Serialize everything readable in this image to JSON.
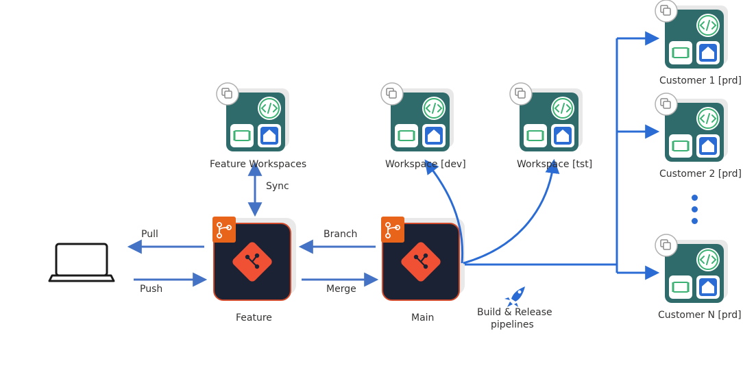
{
  "labels": {
    "pull": "Pull",
    "push": "Push",
    "feature": "Feature",
    "sync": "Sync",
    "feature_ws": "Feature Workspaces",
    "branch": "Branch",
    "merge": "Merge",
    "main": "Main",
    "ws_dev": "Workspace [dev]",
    "ws_tst": "Workspace [tst]",
    "pipelines_l1": "Build & Release",
    "pipelines_l2": "pipelines",
    "cust1": "Customer 1 [prd]",
    "cust2": "Customer 2 [prd]",
    "custN": "Customer N [prd]"
  }
}
